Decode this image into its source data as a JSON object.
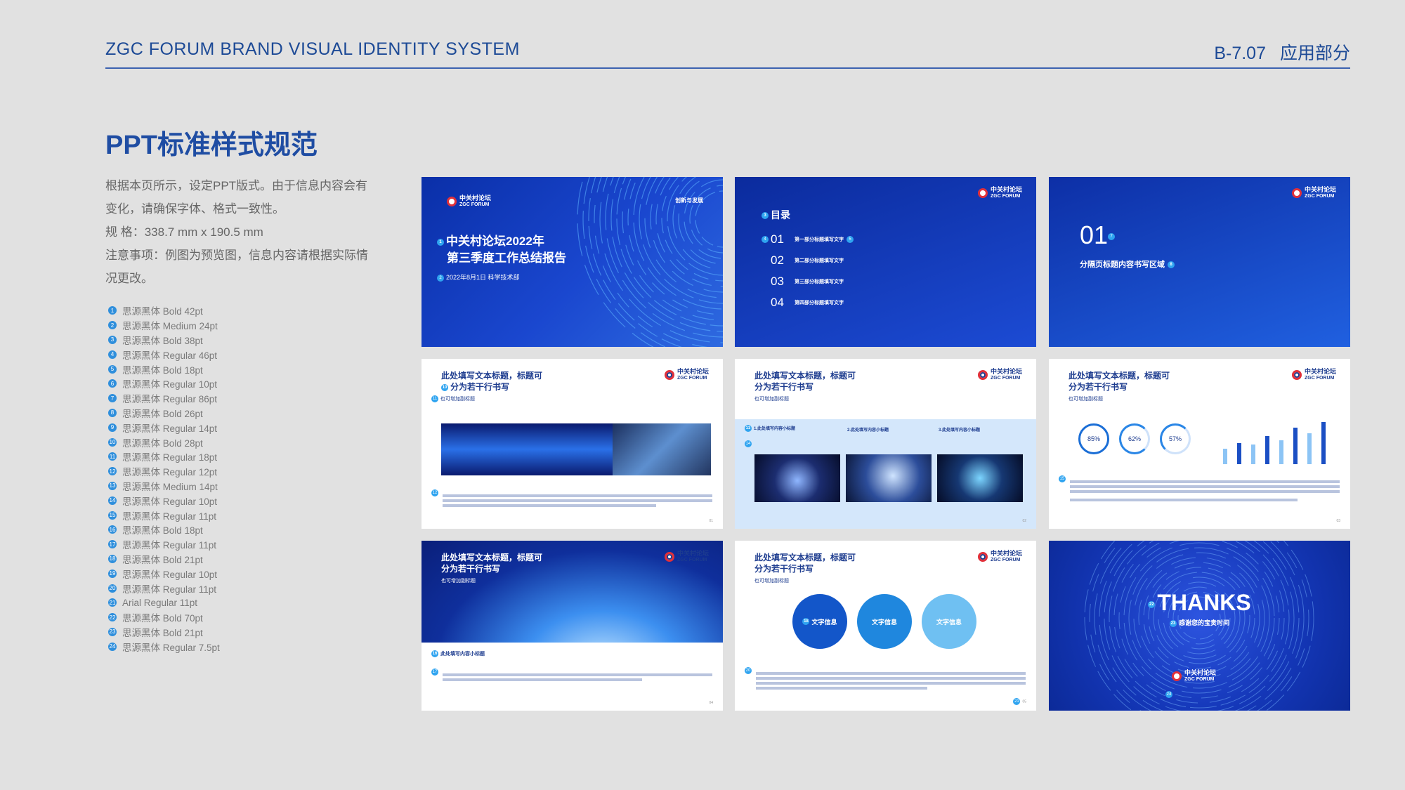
{
  "header": {
    "left": "ZGC FORUM BRAND VISUAL IDENTITY SYSTEM",
    "code": "B-7.07",
    "section": "应用部分"
  },
  "title": "PPT标准样式规范",
  "description": {
    "line1": "根据本页所示，设定PPT版式。由于信息内容会有",
    "line2": "变化，请确保字体、格式一致性。",
    "line3": "规  格：338.7 mm x 190.5 mm",
    "line4": "注意事项：例图为预览图，信息内容请根据实际情",
    "line5": "况更改。"
  },
  "font_specs": [
    {
      "num": "1",
      "text": "思源黑体 Bold 42pt"
    },
    {
      "num": "2",
      "text": "思源黑体 Medium 24pt"
    },
    {
      "num": "3",
      "text": "思源黑体 Bold 38pt"
    },
    {
      "num": "4",
      "text": "思源黑体 Regular 46pt"
    },
    {
      "num": "5",
      "text": "思源黑体 Bold 18pt"
    },
    {
      "num": "6",
      "text": "思源黑体 Regular 10pt"
    },
    {
      "num": "7",
      "text": "思源黑体 Regular 86pt"
    },
    {
      "num": "8",
      "text": "思源黑体 Bold 26pt"
    },
    {
      "num": "9",
      "text": "思源黑体 Regular 14pt"
    },
    {
      "num": "10",
      "text": "思源黑体 Bold 28pt"
    },
    {
      "num": "11",
      "text": "思源黑体 Regular 18pt"
    },
    {
      "num": "12",
      "text": "思源黑体 Regular 12pt"
    },
    {
      "num": "13",
      "text": "思源黑体 Medium 14pt"
    },
    {
      "num": "14",
      "text": "思源黑体 Regular 10pt"
    },
    {
      "num": "15",
      "text": "思源黑体 Regular 11pt"
    },
    {
      "num": "16",
      "text": "思源黑体 Bold 18pt"
    },
    {
      "num": "17",
      "text": "思源黑体 Regular 11pt"
    },
    {
      "num": "18",
      "text": "思源黑体 Bold 21pt"
    },
    {
      "num": "19",
      "text": "思源黑体 Regular 10pt"
    },
    {
      "num": "20",
      "text": "思源黑体 Regular 11pt"
    },
    {
      "num": "21",
      "text": "Arial Regular 11pt"
    },
    {
      "num": "22",
      "text": "思源黑体 Bold 70pt"
    },
    {
      "num": "23",
      "text": "思源黑体 Bold 21pt"
    },
    {
      "num": "24",
      "text": "思源黑体 Regular 7.5pt"
    }
  ],
  "logo": {
    "cn": "中关村论坛",
    "en": "ZGC FORUM"
  },
  "slides": {
    "cover": {
      "title1": "中关村论坛2022年",
      "title2": "第三季度工作总结报告",
      "date": "2022年8月1日  科学技术部",
      "slogan": "创新与发展"
    },
    "toc": {
      "heading": "目录",
      "items": [
        {
          "no": "01",
          "label": "第一部分标题填写文字"
        },
        {
          "no": "02",
          "label": "第二部分标题填写文字"
        },
        {
          "no": "03",
          "label": "第三部分标题填写文字"
        },
        {
          "no": "04",
          "label": "第四部分标题填写文字"
        }
      ]
    },
    "section": {
      "no": "01",
      "title": "分隔页标题内容书写区域"
    },
    "content_title1": "此处填写文本标题，标题可",
    "content_title2": "分为若干行书写",
    "content_sub": "也可增加副标题",
    "s6_items": [
      "1.此处填写内容小标题",
      "2.此处填写内容小标题",
      "3.此处填写内容小标题"
    ],
    "percents": [
      "85%",
      "62%",
      "57%"
    ],
    "s7_subheading": "此处填写内容小标题",
    "bubbles": [
      "文字信息",
      "文字信息",
      "文字信息"
    ],
    "thanks": {
      "big": "THANKS",
      "sub": "感谢您的宝贵时间"
    },
    "pages": {
      "p1": "01",
      "p2": "02",
      "p3": "03",
      "p4": "04",
      "p5": "05"
    }
  },
  "colors": {
    "brand": "#1f4da3",
    "accent": "#2f8fdc",
    "slide_dark": "#1238b8"
  }
}
